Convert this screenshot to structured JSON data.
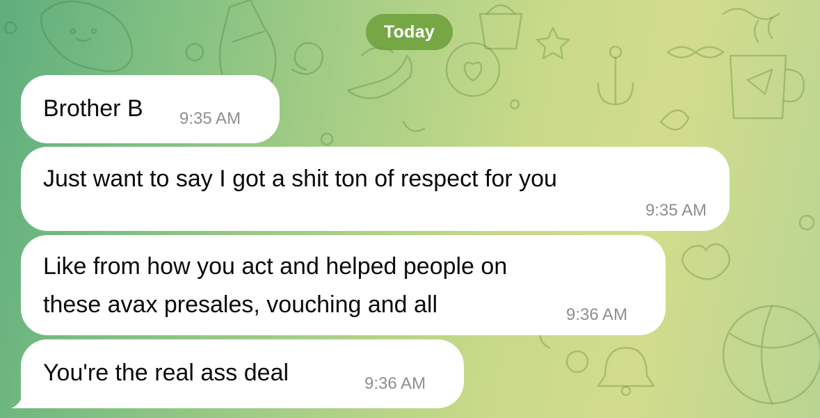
{
  "chat": {
    "date_separator": "Today",
    "messages": [
      {
        "text": "Brother B",
        "time": "9:35 AM"
      },
      {
        "text": "Just want to say I got a shit ton of respect for you",
        "time": "9:35 AM"
      },
      {
        "lines": [
          "Like from how you act and helped people on",
          "these avax presales, vouching and all"
        ],
        "time": "9:36 AM"
      },
      {
        "text": "You're the real ass deal",
        "time": "9:36 AM"
      }
    ]
  },
  "colors": {
    "background_left": "#5fae7e",
    "background_right": "#d2dc8c",
    "date_pill": "#6ea03c",
    "bubble": "#ffffff",
    "message_text": "#0a0a0a",
    "time_text": "#8e8e93"
  },
  "background_pattern_icons": [
    "cat-icon",
    "bottle-icon",
    "banana-icon",
    "heart-icon",
    "anchor-icon",
    "mug-icon",
    "star-icon",
    "leaf-icon",
    "ball-icon",
    "bell-icon",
    "cup-icon",
    "spiral-icon"
  ]
}
